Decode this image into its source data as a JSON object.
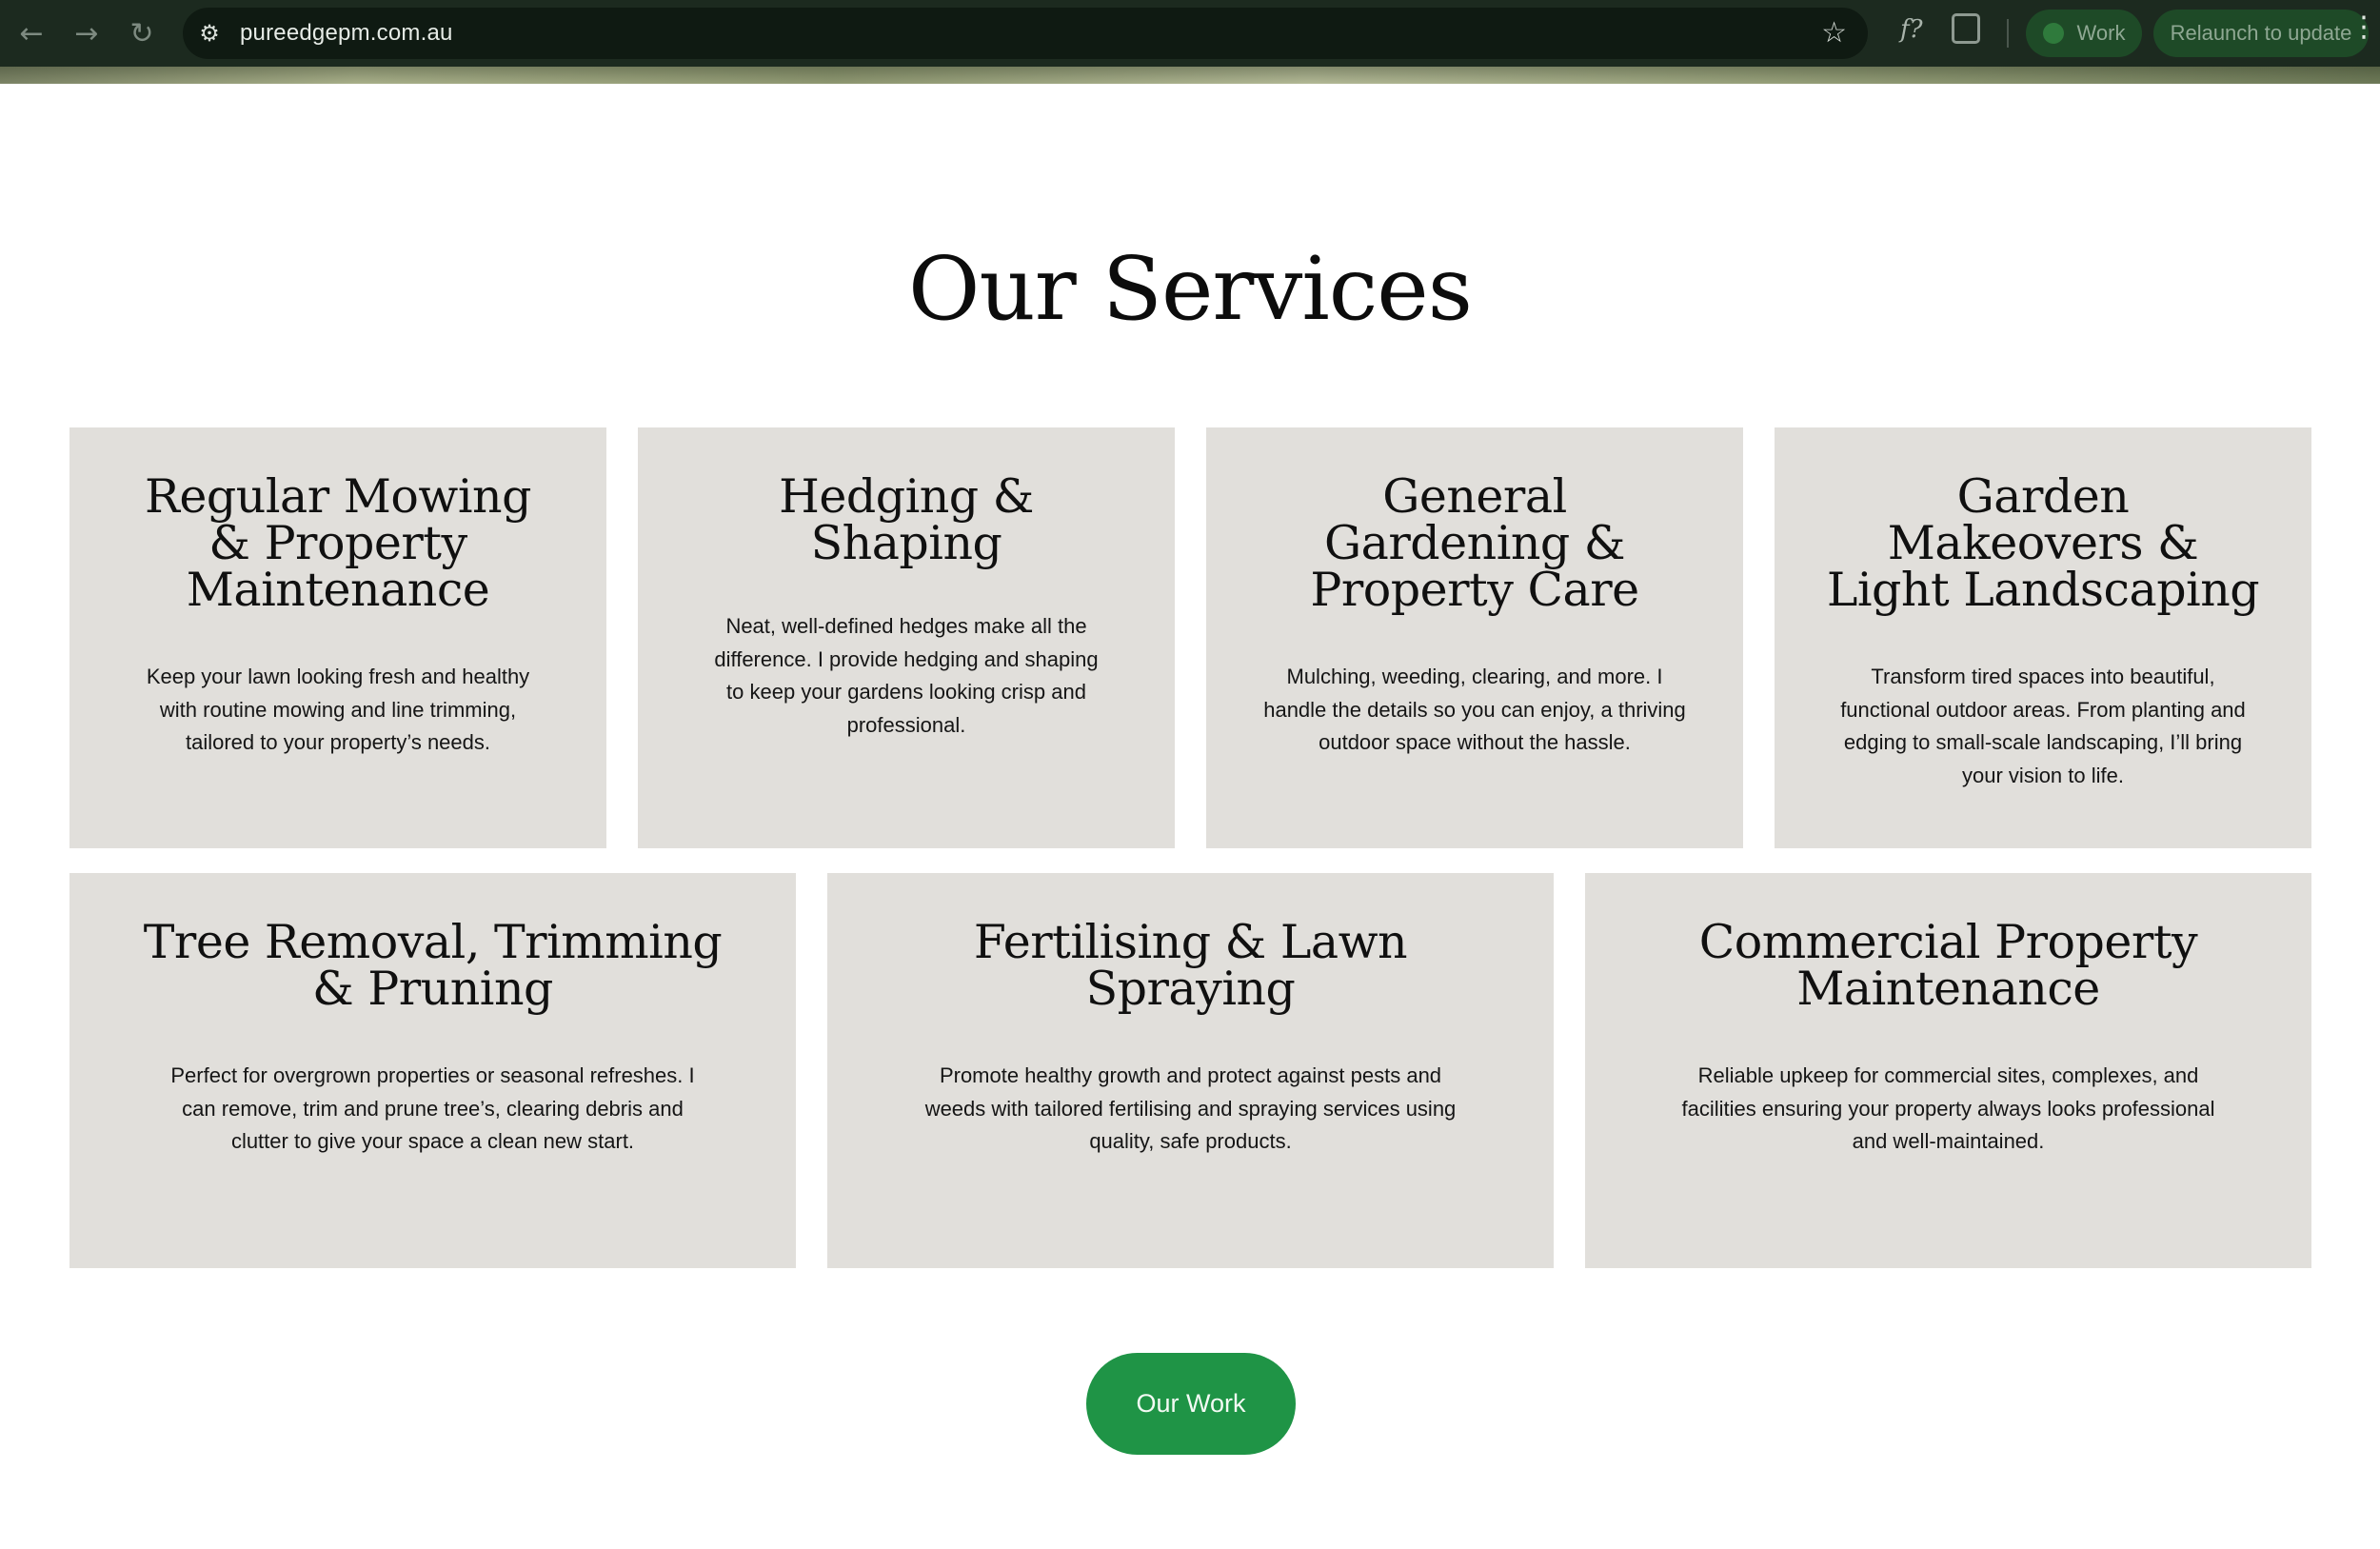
{
  "browser": {
    "url": "pureedgepm.com.au",
    "profile_label": "Work",
    "relaunch_label": "Relaunch to update",
    "back_glyph": "←",
    "forward_glyph": "→",
    "reload_glyph": "↻",
    "site_info_glyph": "⚙",
    "star_glyph": "☆",
    "formula_glyph": "f?",
    "menu_glyph": "⋮"
  },
  "services": {
    "title": "Our Services",
    "cards": [
      {
        "title": "Regular Mowing & Property Maintenance",
        "description": "Keep your lawn looking fresh and healthy with routine mowing and line trimming, tailored to your property’s needs."
      },
      {
        "title": "Hedging & Shaping",
        "description": "Neat, well-defined hedges make all the difference. I provide hedging and shaping to keep your gardens looking crisp and professional."
      },
      {
        "title": "General Gardening & Property Care",
        "description": "Mulching, weeding, clearing, and more. I handle the details so you can enjoy, a thriving outdoor space without the hassle."
      },
      {
        "title": "Garden Makeovers & Light Landscaping",
        "description": "Transform tired spaces into beautiful, functional outdoor areas. From planting and edging to small-scale landscaping, I’ll bring your vision to life."
      },
      {
        "title": "Tree Removal, Trimming & Pruning",
        "description": "Perfect for overgrown properties or seasonal refreshes. I can remove, trim and prune tree’s, clearing debris and clutter to give your space a clean new start."
      },
      {
        "title": "Fertilising & Lawn Spraying",
        "description": "Promote healthy growth and protect against pests and weeds with tailored fertilising and spraying services using quality, safe products."
      },
      {
        "title": "Commercial Property Maintenance",
        "description": "Reliable upkeep for commercial sites, complexes, and facilities ensuring your property always looks professional and well-maintained."
      }
    ],
    "cta_label": "Our Work"
  },
  "colors": {
    "card_bg": "#e1dfdb",
    "cta_bg": "#1f9446",
    "chrome_bg": "#1c2a1f"
  }
}
